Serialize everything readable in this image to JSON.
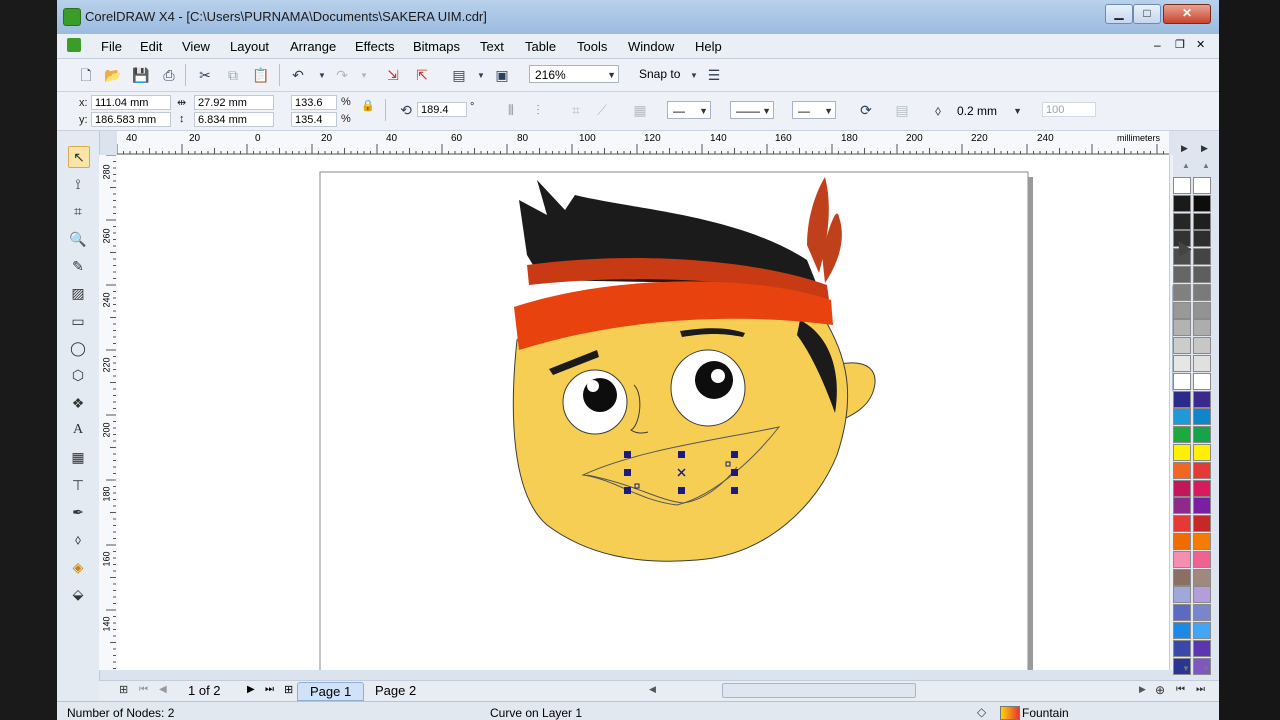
{
  "window": {
    "title": "CorelDRAW X4 - [C:\\Users\\PURNAMA\\Documents\\SAKERA UIM.cdr]",
    "buttons": {
      "minimize": "▁",
      "maximize": "□",
      "close": "✕"
    },
    "mdi_buttons": {
      "minimize": "–",
      "restore": "❐",
      "close": "✕"
    }
  },
  "menu": [
    "File",
    "Edit",
    "View",
    "Layout",
    "Arrange",
    "Effects",
    "Bitmaps",
    "Text",
    "Table",
    "Tools",
    "Window",
    "Help"
  ],
  "standard_toolbar": {
    "zoom_value": "216%",
    "snap_to_label": "Snap to"
  },
  "property_bar": {
    "x_label": "x:",
    "x_value": "111.04 mm",
    "y_label": "y:",
    "y_value": "186.583 mm",
    "width_value": "27.92 mm",
    "height_value": "6.834 mm",
    "scale_x": "133.6",
    "scale_y": "135.4",
    "percent": "%",
    "rotation_value": "189.4",
    "degree": "°",
    "outline_width": "0.2 mm",
    "smoothing_value": "100"
  },
  "ruler": {
    "h_labels": [
      "40",
      "20",
      "0",
      "20",
      "40",
      "60",
      "80",
      "100",
      "120",
      "140",
      "160",
      "180",
      "200",
      "220",
      "240"
    ],
    "h_unit": "millimeters",
    "v_labels": [
      "280",
      "260",
      "240",
      "220",
      "200",
      "180",
      "160",
      "140"
    ],
    "v_unit": "millimeters"
  },
  "page_nav": {
    "counter": "1 of 2",
    "tabs": [
      "Page 1",
      "Page 2"
    ]
  },
  "status": {
    "left": "Number of Nodes: 2",
    "center": "Curve on Layer 1",
    "fill_label": "Fountain"
  },
  "palette": {
    "left": [
      "#ffffff",
      "#1a1a1a",
      "#262626",
      "#333333",
      "#4d4d4d",
      "#666666",
      "#808080",
      "#999999",
      "#b3b3b3",
      "#cccccc",
      "#e6e6e6",
      "#ffffff",
      "#2b2b8c",
      "#1f9ad6",
      "#1fa83b",
      "#fff000",
      "#f26522",
      "#c2185b",
      "#8e2a8a",
      "#e53935",
      "#ef6c00",
      "#f48fb1",
      "#8d6e63",
      "#9fa8da",
      "#5c6bc0",
      "#1e88e5",
      "#3949ab",
      "#283593"
    ],
    "right": [
      "#ffffff",
      "#0d0d0d",
      "#1f1f1f",
      "#2e2e2e",
      "#444444",
      "#5e5e5e",
      "#7a7a7a",
      "#939393",
      "#adadad",
      "#c7c7c7",
      "#e0e0e0",
      "#ffffff",
      "#3a2a8f",
      "#0f86c9",
      "#16a34a",
      "#ffef00",
      "#e53935",
      "#d81b60",
      "#7b1fa2",
      "#c62828",
      "#f57c00",
      "#f06292",
      "#a1887f",
      "#b39ddb",
      "#7986cb",
      "#42a5f5",
      "#5e35b1",
      "#7e57c2"
    ]
  },
  "colors": {
    "skin": "#f7ce54",
    "hair": "#1b1b1b",
    "headband": "#e8420e",
    "headband_back": "#c73a14",
    "feather": "#c0401b",
    "selection": "#1a1a80"
  }
}
